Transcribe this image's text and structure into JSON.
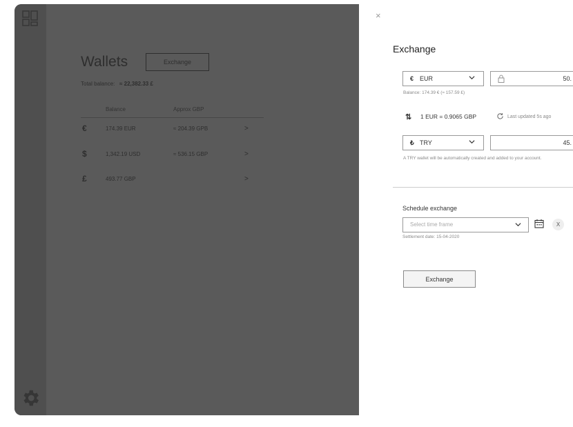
{
  "wallets": {
    "title": "Wallets",
    "exchange_label": "Exchange",
    "total_label": "Total balance:",
    "total_value": "≈ 22,382.33 £",
    "columns": [
      "Balance",
      "Approx GBP"
    ],
    "rows": [
      {
        "symbol": "€",
        "balance": "174.39 EUR",
        "approx": "≈ 204.39 GPB",
        "chevron": ">"
      },
      {
        "symbol": "$",
        "balance": "1,342.19 USD",
        "approx": "≈ 536.15 GBP",
        "chevron": ">"
      },
      {
        "symbol": "£",
        "balance": "493.77 GBP",
        "approx": "",
        "chevron": ">"
      }
    ]
  },
  "panel": {
    "close": "×",
    "title": "Exchange",
    "from": {
      "symbol": "€",
      "code": "EUR",
      "amount": "50."
    },
    "balance_note": "Balance: 174.39 € (≈ 157.59 £)",
    "rate_icon": "⇅",
    "rate": "1 EUR = 0.9065 GBP",
    "updated": "Last updated 5s ago",
    "to": {
      "symbol": "₺",
      "code": "TRY",
      "amount": "45."
    },
    "to_note": "A TRY wallet will be automatically created and added to your account.",
    "schedule_label": "Schedule exchange",
    "time_placeholder": "Select time frame",
    "clear": "X",
    "settlement": "Settlement date: 15-04-2020",
    "exchange_button": "Exchange"
  }
}
